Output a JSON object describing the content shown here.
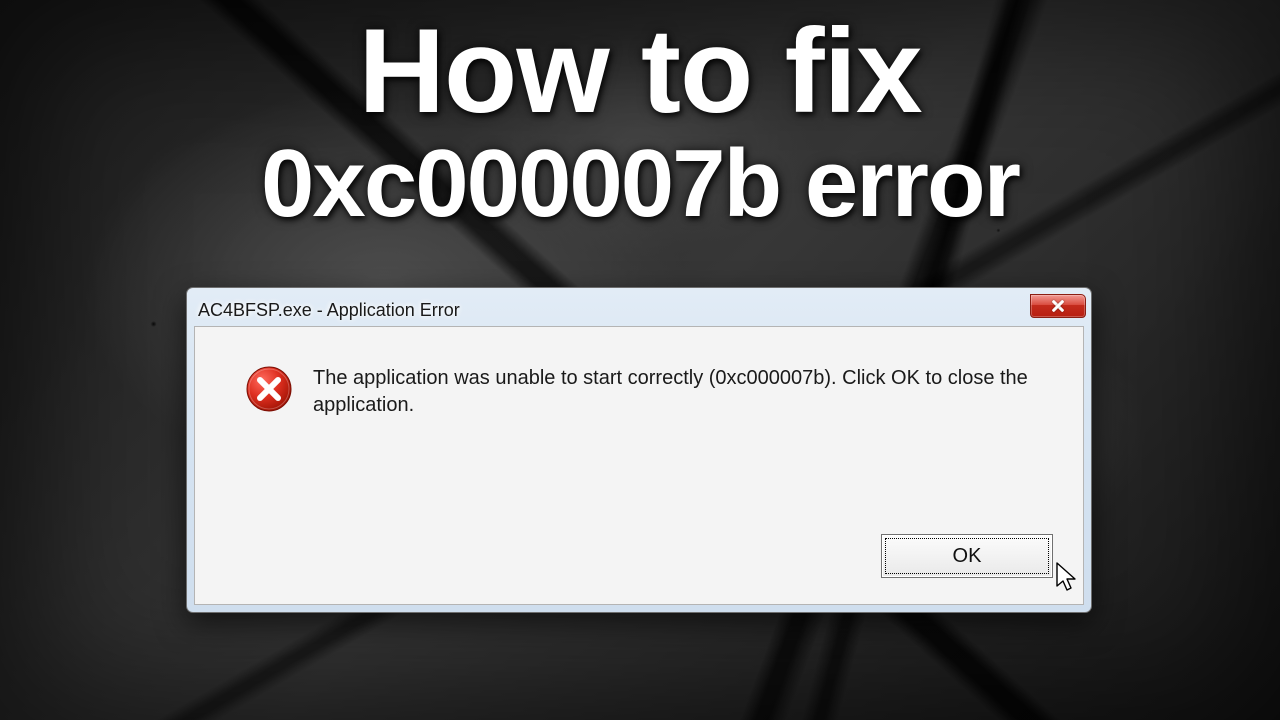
{
  "headline": {
    "line1": "How to fix",
    "line2": "0xc000007b error"
  },
  "dialog": {
    "title": "AC4BFSP.exe - Application Error",
    "message": "The application was unable to start correctly (0xc000007b). Click OK to close the application.",
    "ok_label": "OK"
  }
}
